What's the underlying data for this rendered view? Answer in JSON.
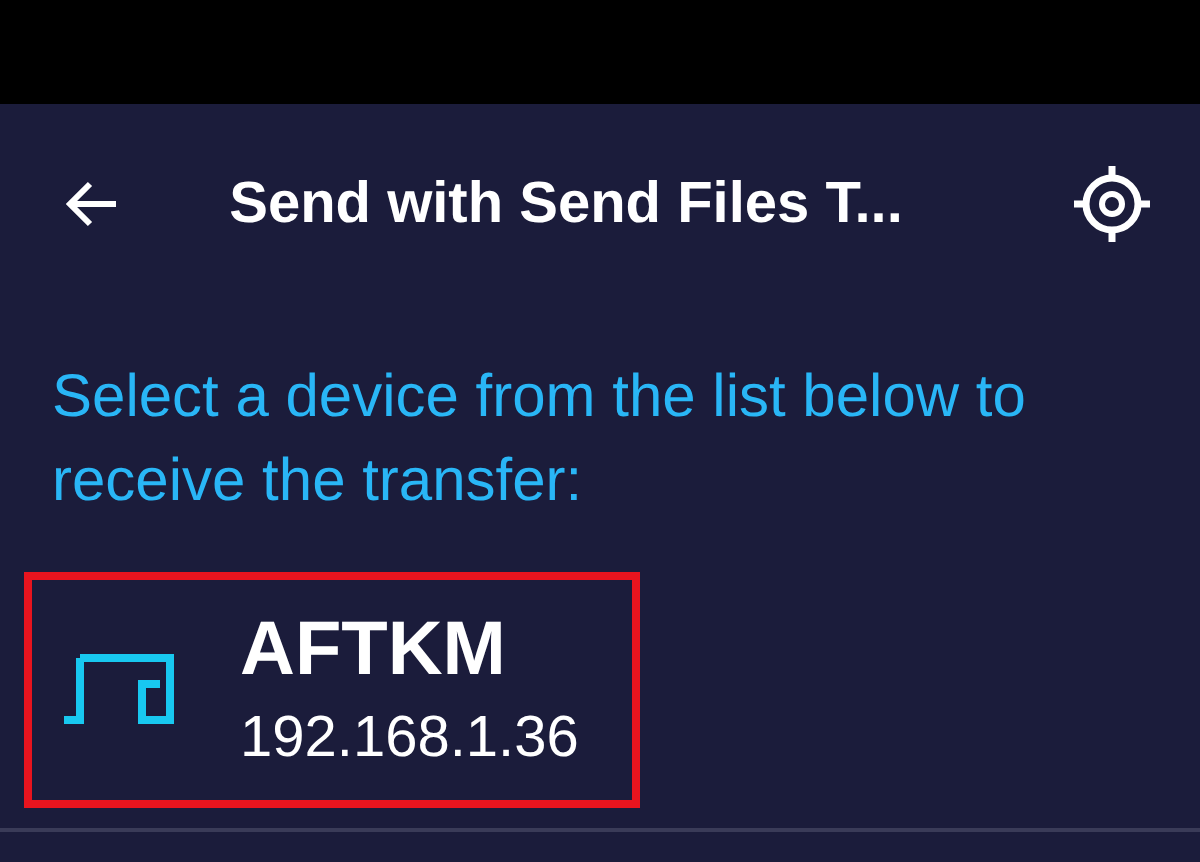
{
  "app_bar": {
    "title": "Send with Send Files T..."
  },
  "instruction": "Select a device from the list below to receive the transfer:",
  "devices": [
    {
      "name": "AFTKM",
      "address": "192.168.1.36",
      "highlighted": true
    }
  ]
}
